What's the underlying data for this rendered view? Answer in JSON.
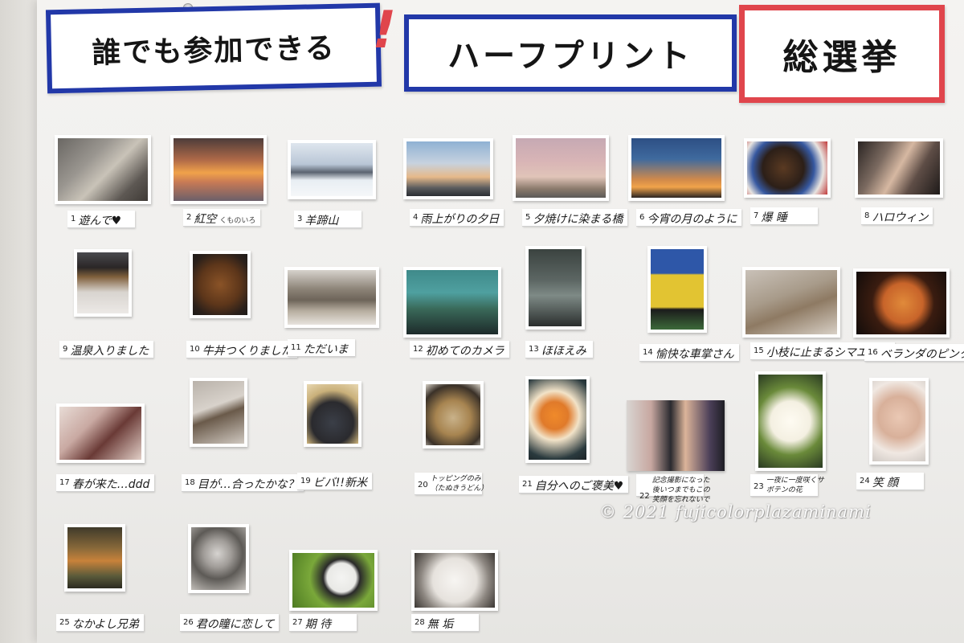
{
  "header": {
    "banner_left": "誰でも参加できる",
    "exclamation": "!",
    "banner_center": "ハーフプリント",
    "banner_right": "総選挙"
  },
  "entries": [
    {
      "num": "1",
      "title": "遊んで♥",
      "sub": ""
    },
    {
      "num": "2",
      "title": "紅空",
      "sub": "くものいろ"
    },
    {
      "num": "3",
      "title": "羊蹄山",
      "sub": ""
    },
    {
      "num": "4",
      "title": "雨上がりの夕日",
      "sub": ""
    },
    {
      "num": "5",
      "title": "夕焼けに染まる橋",
      "sub": ""
    },
    {
      "num": "6",
      "title": "今宵の月のように",
      "sub": ""
    },
    {
      "num": "7",
      "title": "爆 睡",
      "sub": ""
    },
    {
      "num": "8",
      "title": "ハロウィン",
      "sub": ""
    },
    {
      "num": "9",
      "title": "温泉入りました",
      "sub": ""
    },
    {
      "num": "10",
      "title": "牛丼つくりました",
      "sub": ""
    },
    {
      "num": "11",
      "title": "ただいま",
      "sub": ""
    },
    {
      "num": "12",
      "title": "初めてのカメラ",
      "sub": ""
    },
    {
      "num": "13",
      "title": "ほほえみ",
      "sub": ""
    },
    {
      "num": "14",
      "title": "愉快な車掌さん",
      "sub": ""
    },
    {
      "num": "15",
      "title": "小枝に止まるシマエナガ",
      "sub": ""
    },
    {
      "num": "16",
      "title": "ベランダのピンクムーン",
      "sub": ""
    },
    {
      "num": "17",
      "title": "春が来た…ddd",
      "sub": ""
    },
    {
      "num": "18",
      "title": "目が…合ったかな？",
      "sub": ""
    },
    {
      "num": "19",
      "title": "ビバ!!新米",
      "sub": ""
    },
    {
      "num": "20",
      "title": "トッピングのみ（たぬきうどん）",
      "sub": ""
    },
    {
      "num": "21",
      "title": "自分へのご褒美♥",
      "sub": ""
    },
    {
      "num": "22",
      "title": "記念撮影になった後いつまでもこの笑顔を忘れないで",
      "sub": ""
    },
    {
      "num": "23",
      "title": "一夜に一度咲くサボテンの花",
      "sub": ""
    },
    {
      "num": "24",
      "title": "笑 顔",
      "sub": ""
    },
    {
      "num": "25",
      "title": "なかよし兄弟",
      "sub": ""
    },
    {
      "num": "26",
      "title": "君の瞳に恋して",
      "sub": ""
    },
    {
      "num": "27",
      "title": "期 待",
      "sub": ""
    },
    {
      "num": "28",
      "title": "無 垢",
      "sub": ""
    }
  ],
  "watermark": "© 2021 fujicolorplazaminami",
  "colors": {
    "banner_blue": "#2238a8",
    "banner_red": "#e0454c",
    "board": "#f1f0ee"
  }
}
